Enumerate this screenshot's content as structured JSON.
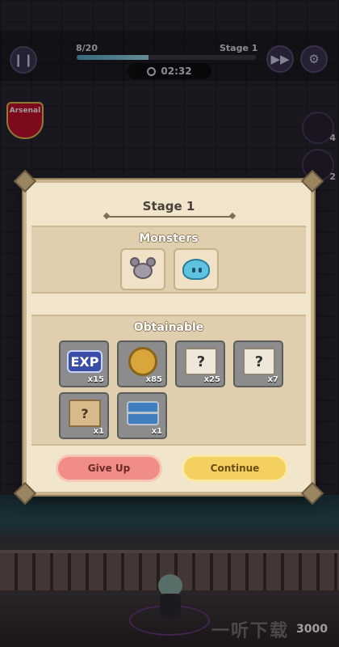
{
  "hud": {
    "wave_progress": "8/20",
    "stage_label": "Stage 1",
    "progress_fraction": 0.4,
    "timer": "02:32",
    "team_badge": "Arsenal",
    "score": "3000"
  },
  "side_skills": [
    {
      "count": "4"
    },
    {
      "count": "2"
    }
  ],
  "watermark": "一听下载",
  "dialog": {
    "title": "Stage 1",
    "monsters_title": "Monsters",
    "monsters": [
      {
        "icon": "mouse-monster-icon"
      },
      {
        "icon": "slime-monster-icon"
      }
    ],
    "obtainable_title": "Obtainable",
    "items": [
      {
        "icon": "exp-icon",
        "label": "EXP",
        "qty": "x15"
      },
      {
        "icon": "gold-coin-icon",
        "label": "",
        "qty": "x85"
      },
      {
        "icon": "mystery-scroll-icon",
        "label": "?",
        "qty": "x25"
      },
      {
        "icon": "mystery-scroll-icon",
        "label": "?",
        "qty": "x7"
      },
      {
        "icon": "mystery-map-icon",
        "label": "?",
        "qty": "x1"
      },
      {
        "icon": "treasure-chest-icon",
        "label": "",
        "qty": "x1"
      }
    ],
    "give_up_label": "Give Up",
    "continue_label": "Continue"
  },
  "colors": {
    "dialog_bg": "#f1e5cc",
    "give_up": "#f08d86",
    "continue": "#f4d060"
  }
}
